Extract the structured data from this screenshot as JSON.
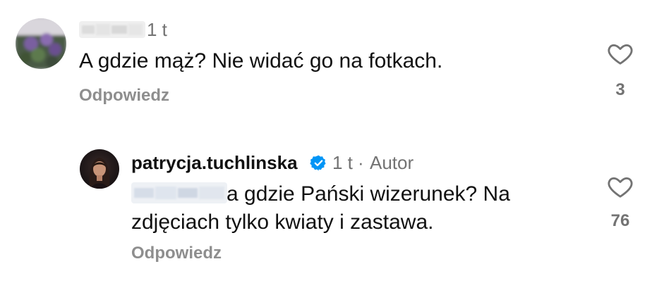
{
  "comments": [
    {
      "username": "",
      "time": "1 t",
      "text": "A gdzie mąż? Nie widać go na fotkach.",
      "reply_label": "Odpowiedz",
      "like_count": "3",
      "avatar_icon": "blurred-avatar",
      "username_blurred": true
    },
    {
      "username": "patrycja.tuchlinska",
      "verified": true,
      "time": "1 t",
      "separator": "·",
      "author_badge": "Autor",
      "mention_blurred": true,
      "text": "a gdzie Pański wizerunek? Na zdjęciach tylko kwiaty i zastawa.",
      "reply_label": "Odpowiedz",
      "like_count": "76",
      "avatar_icon": "profile-photo"
    }
  ],
  "colors": {
    "text": "#111111",
    "secondary": "#737373",
    "reply": "#8e8e8e",
    "verified": "#0095f6",
    "background": "#ffffff"
  },
  "icons": {
    "like": "heart-outline-icon",
    "verified": "verified-badge-icon"
  }
}
